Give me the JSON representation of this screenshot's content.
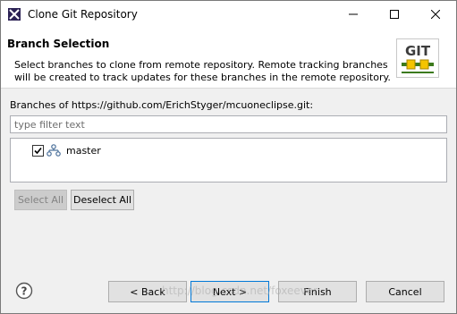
{
  "window": {
    "title": "Clone Git Repository",
    "controls": {
      "minimize": "minimize",
      "maximize": "maximize",
      "close": "close"
    }
  },
  "header": {
    "title": "Branch Selection",
    "description_lines": [
      "Select branches to clone from remote repository. Remote tracking branches",
      "will be created to track updates for these branches in the remote repository."
    ],
    "logo_text": "GIT"
  },
  "branches": {
    "label": "Branches of https://github.com/ErichStyger/mcuoneclipse.git:",
    "filter_placeholder": "type filter text",
    "items": [
      {
        "name": "master",
        "checked": true
      }
    ],
    "select_all": "Select All",
    "deselect_all": "Deselect All"
  },
  "footer": {
    "back": "< Back",
    "next": "Next >",
    "finish": "Finish",
    "cancel": "Cancel"
  },
  "watermark": "http://blog.csdn.net/foxeever",
  "colors": {
    "accent": "#0078d7",
    "disabled_text": "#838383",
    "logo_green": "#3c7a1d",
    "logo_yellow": "#f5c400"
  }
}
